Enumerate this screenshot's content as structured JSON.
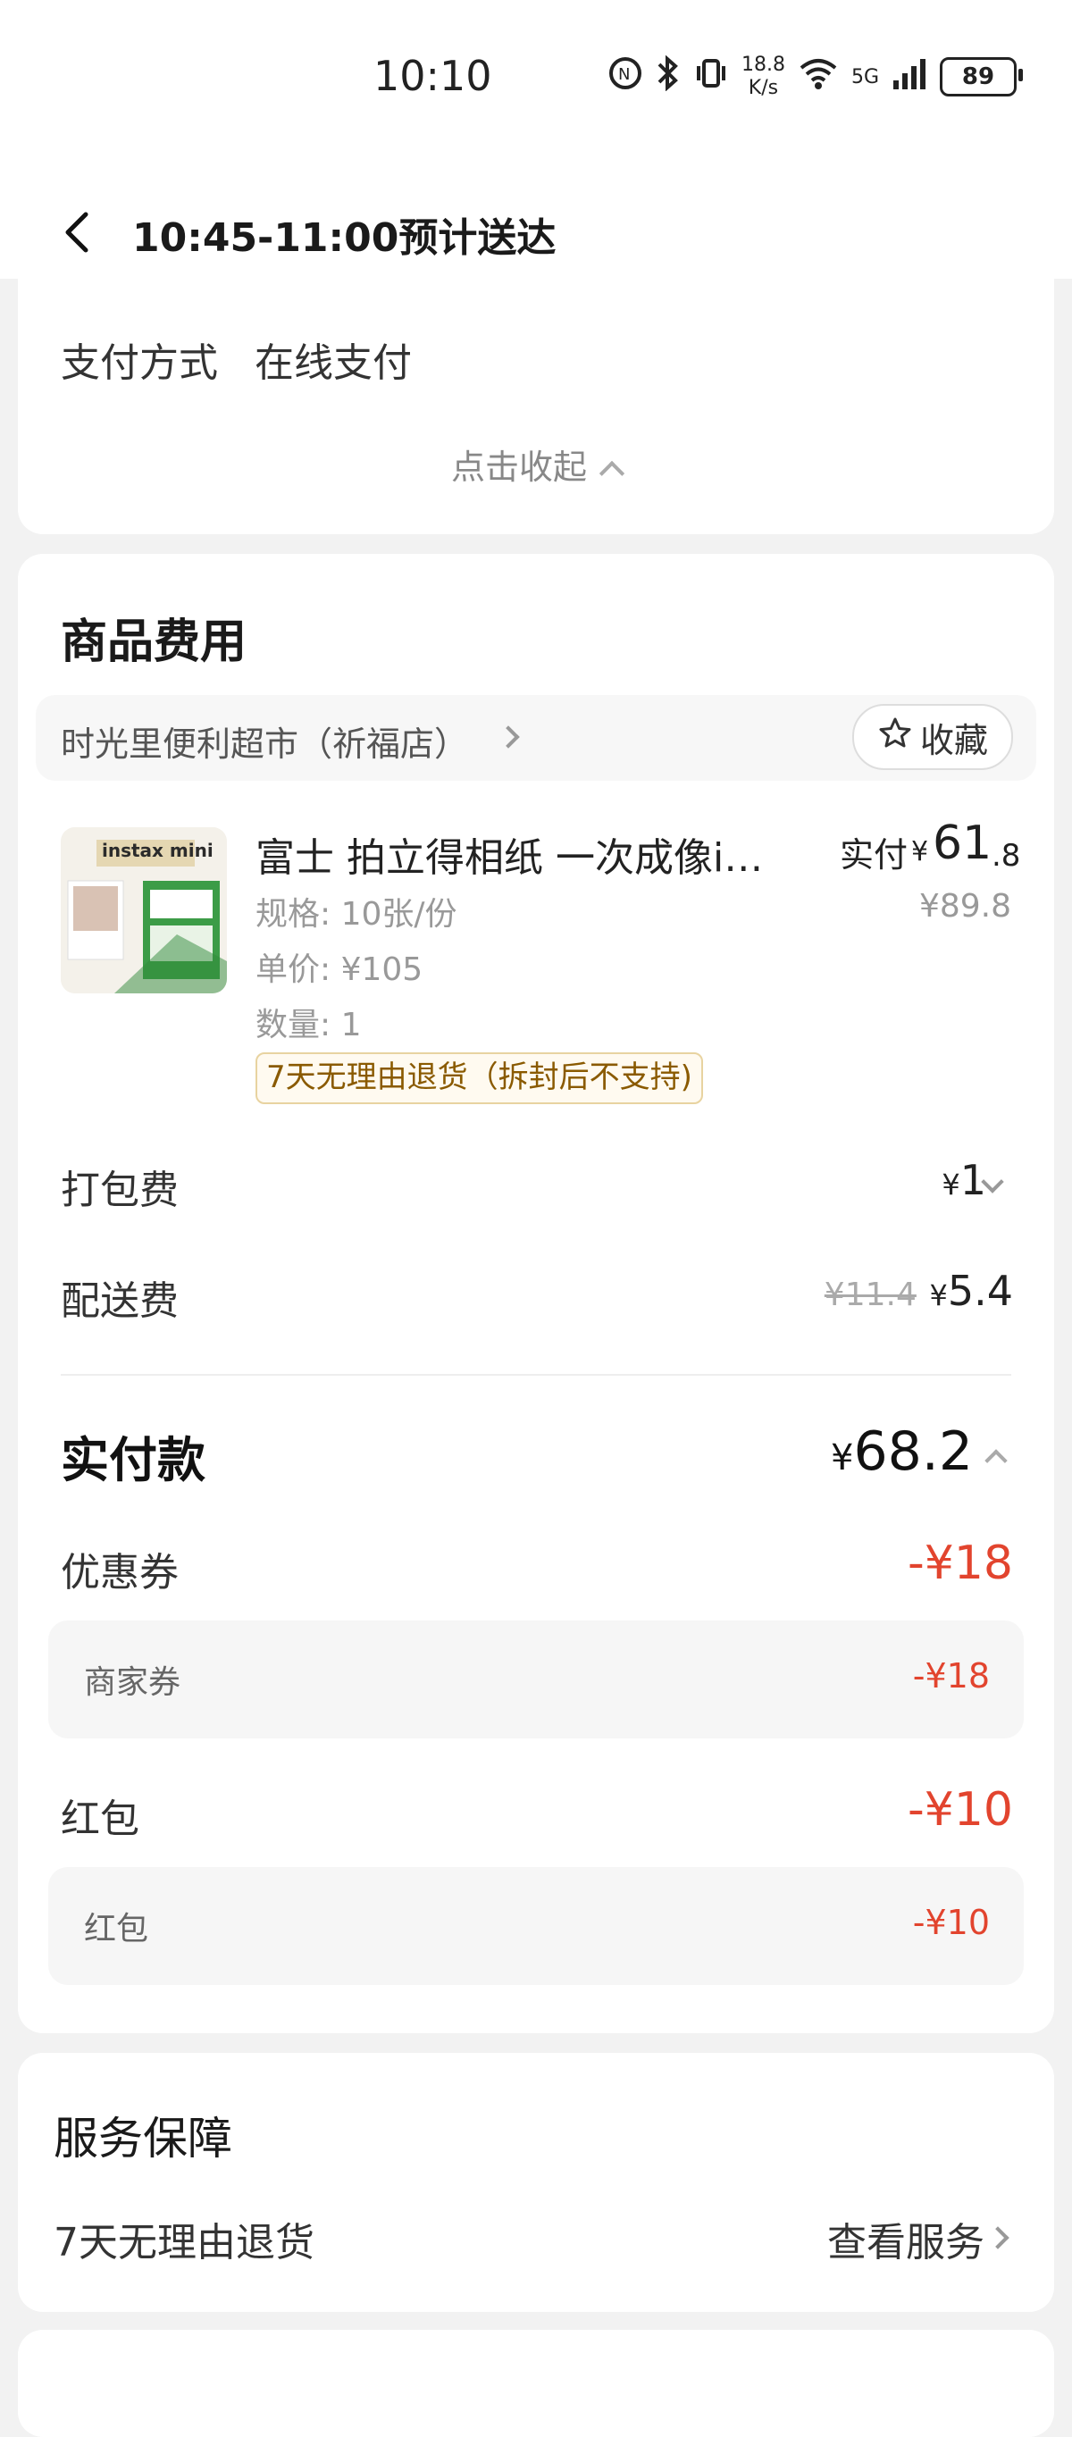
{
  "status_bar": {
    "time": "10:10",
    "speed_value": "18.8",
    "speed_unit": "K/s",
    "network": "5G",
    "battery": "89"
  },
  "header": {
    "title": "10:45-11:00预计送达"
  },
  "payment": {
    "label": "支付方式",
    "value": "在线支付",
    "collapse_label": "点击收起"
  },
  "goods": {
    "section_title": "商品费用",
    "store_name": "时光里便利超市（祈福店）",
    "favorite_label": "收藏",
    "product": {
      "name": "富士 拍立得相纸 一次成像i…",
      "paid_label": "实付",
      "paid_symbol": "¥",
      "paid_int": "61",
      "paid_dec": ".8",
      "original_price": "¥89.8",
      "spec": "规格: 10张/份",
      "unit_price": "单价: ¥105",
      "quantity": "数量: 1",
      "return_tag": "7天无理由退货（拆封后不支持)",
      "image_brand": "instax mini"
    },
    "packing": {
      "label": "打包费",
      "symbol": "¥",
      "value": "1"
    },
    "delivery": {
      "label": "配送费",
      "original": "¥11.4",
      "symbol": "¥",
      "value": "5.4"
    },
    "total": {
      "label": "实付款",
      "symbol": "¥",
      "value": "68.2"
    },
    "coupon": {
      "label": "优惠券",
      "value": "-¥18",
      "sub_label": "商家券",
      "sub_value": "-¥18"
    },
    "red_packet": {
      "label": "红包",
      "value": "-¥10",
      "sub_label": "红包",
      "sub_value": "-¥10"
    }
  },
  "service": {
    "title": "服务保障",
    "item": "7天无理由退货",
    "link": "查看服务"
  },
  "colors": {
    "discount_red": "#e2442e",
    "tag_brown": "#8a5a00",
    "background": "#f2f2f2"
  }
}
